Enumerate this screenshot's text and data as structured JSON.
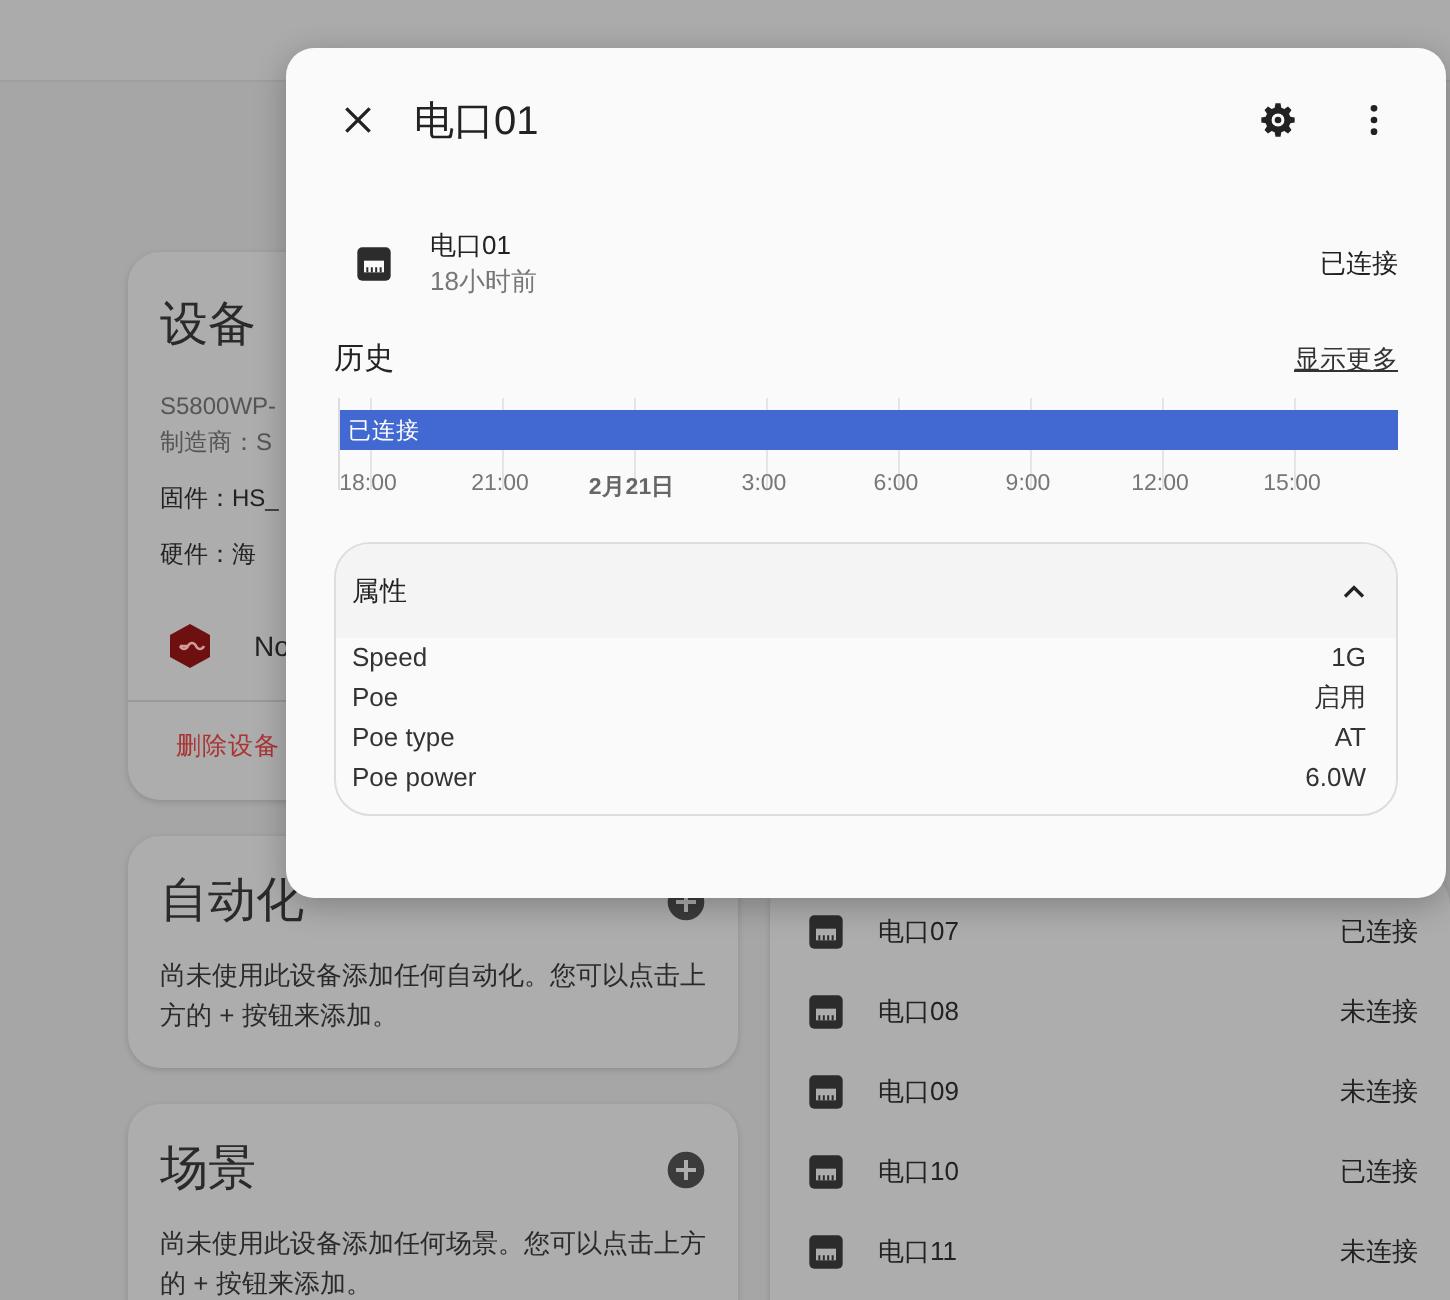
{
  "page": {
    "device_card": {
      "title": "设备",
      "lines": [
        "S5800WP-",
        "制造商：S"
      ],
      "fields": [
        "固件：HS_",
        "硬件：海"
      ],
      "integration": "No",
      "delete_label": "删除设备"
    },
    "automation_card": {
      "title": "自动化",
      "text": "尚未使用此设备添加任何自动化。您可以点击上方的 + 按钮来添加。"
    },
    "scene_card": {
      "title": "场景",
      "text": "尚未使用此设备添加任何场景。您可以点击上方的 + 按钮来添加。"
    },
    "ports": [
      {
        "name": "电口07",
        "state": "已连接"
      },
      {
        "name": "电口08",
        "state": "未连接"
      },
      {
        "name": "电口09",
        "state": "未连接"
      },
      {
        "name": "电口10",
        "state": "已连接"
      },
      {
        "name": "电口11",
        "state": "未连接"
      }
    ]
  },
  "dialog": {
    "title": "电口01",
    "entity": {
      "name": "电口01",
      "changed": "18小时前",
      "state": "已连接"
    },
    "history": {
      "title": "历史",
      "more_link": "显示更多",
      "bar_label": "已连接",
      "ticks": [
        {
          "label": "18:00",
          "kind": "time"
        },
        {
          "label": "21:00",
          "kind": "time"
        },
        {
          "label": "2月21日",
          "kind": "date"
        },
        {
          "label": "3:00",
          "kind": "time"
        },
        {
          "label": "6:00",
          "kind": "time"
        },
        {
          "label": "9:00",
          "kind": "time"
        },
        {
          "label": "12:00",
          "kind": "time"
        },
        {
          "label": "15:00",
          "kind": "time"
        }
      ]
    },
    "attributes": {
      "title": "属性",
      "expanded": true,
      "rows": [
        {
          "name": "Speed",
          "value": "1G"
        },
        {
          "name": "Poe",
          "value": "启用"
        },
        {
          "name": "Poe type",
          "value": "AT"
        },
        {
          "name": "Poe power",
          "value": "6.0W"
        }
      ]
    }
  }
}
